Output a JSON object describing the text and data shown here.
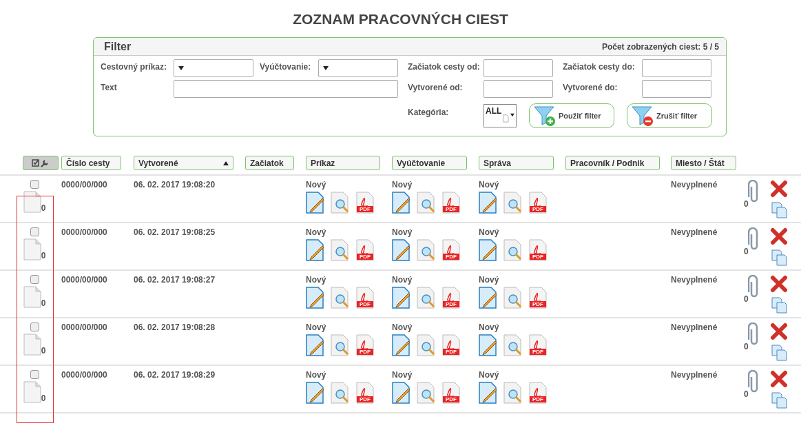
{
  "title": "ZOZNAM PRACOVNÝCH CIEST",
  "filter": {
    "title": "Filter",
    "count_label": "Počet zobrazených ciest: 5 / 5",
    "fields": [
      {
        "label": "Cestovný príkaz:",
        "kind": "select"
      },
      {
        "label": "Vyúčtovanie:",
        "kind": "select"
      },
      {
        "label": "Začiatok cesty od:",
        "kind": "input"
      },
      {
        "label": "Začiatok cesty do:",
        "kind": "input"
      },
      {
        "label": "Text",
        "kind": "input"
      },
      {
        "label": "Vytvorené od:",
        "kind": "input"
      },
      {
        "label": "Vytvorené do:",
        "kind": "input"
      }
    ],
    "category": {
      "label": "Kategória:",
      "value": "ALL"
    },
    "buttons": [
      {
        "label": "Použiť filter",
        "kind": "apply"
      },
      {
        "label": "Zrušiť filter",
        "kind": "cancel"
      }
    ]
  },
  "columns": [
    {
      "label": "Číslo cesty",
      "sorted": false
    },
    {
      "label": "Vytvorené",
      "sorted": true
    },
    {
      "label": "Začiatok",
      "sorted": false
    },
    {
      "label": "Príkaz",
      "sorted": false
    },
    {
      "label": "Vyúčtovanie",
      "sorted": false
    },
    {
      "label": "Správa",
      "sorted": false
    },
    {
      "label": "Pracovník / Podnik",
      "sorted": false
    },
    {
      "label": "Miesto / Štát",
      "sorted": false
    }
  ],
  "rows": [
    {
      "checked": false,
      "docs": "0",
      "number": "0000/00/000",
      "created": "06. 02. 2017 19:08:20",
      "sections": [
        {
          "status": "Nový",
          "pdf": "PDF"
        },
        {
          "status": "Nový",
          "pdf": "PDF"
        },
        {
          "status": "Nový",
          "pdf": "PDF"
        }
      ],
      "place": "Nevyplnené",
      "attachments": "0"
    },
    {
      "checked": false,
      "docs": "0",
      "number": "0000/00/000",
      "created": "06. 02. 2017 19:08:25",
      "sections": [
        {
          "status": "Nový",
          "pdf": "PDF"
        },
        {
          "status": "Nový",
          "pdf": "PDF"
        },
        {
          "status": "Nový",
          "pdf": "PDF"
        }
      ],
      "place": "Nevyplnené",
      "attachments": "0"
    },
    {
      "checked": false,
      "docs": "0",
      "number": "0000/00/000",
      "created": "06. 02. 2017 19:08:27",
      "sections": [
        {
          "status": "Nový",
          "pdf": "PDF"
        },
        {
          "status": "Nový",
          "pdf": "PDF"
        },
        {
          "status": "Nový",
          "pdf": "PDF"
        }
      ],
      "place": "Nevyplnené",
      "attachments": "0"
    },
    {
      "checked": false,
      "docs": "0",
      "number": "0000/00/000",
      "created": "06. 02. 2017 19:08:28",
      "sections": [
        {
          "status": "Nový",
          "pdf": "PDF"
        },
        {
          "status": "Nový",
          "pdf": "PDF"
        },
        {
          "status": "Nový",
          "pdf": "PDF"
        }
      ],
      "place": "Nevyplnené",
      "attachments": "0"
    },
    {
      "checked": false,
      "docs": "0",
      "number": "0000/00/000",
      "created": "06. 02. 2017 19:08:29",
      "sections": [
        {
          "status": "Nový",
          "pdf": "PDF"
        },
        {
          "status": "Nový",
          "pdf": "PDF"
        },
        {
          "status": "Nový",
          "pdf": "PDF"
        }
      ],
      "place": "Nevyplnené",
      "attachments": "0"
    }
  ]
}
